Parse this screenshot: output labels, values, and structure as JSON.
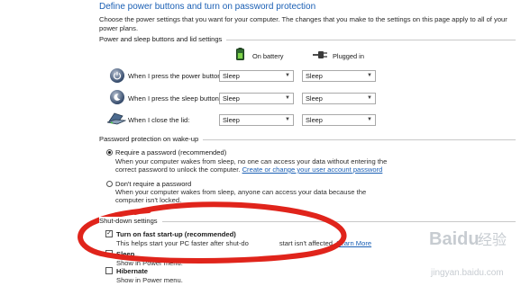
{
  "page": {
    "title": "Define power buttons and turn on password protection",
    "intro": "Choose the power settings that you want for your computer. The changes that you make to the settings on this page apply to all of your power plans."
  },
  "power_section": {
    "heading": "Power and sleep buttons and lid settings",
    "col_battery": "On battery",
    "col_plugged": "Plugged in",
    "rows": [
      {
        "label": "When I press the power button:",
        "battery": "Sleep",
        "plugged": "Sleep",
        "icon": "power-button-icon"
      },
      {
        "label": "When I press the sleep button:",
        "battery": "Sleep",
        "plugged": "Sleep",
        "icon": "sleep-button-icon"
      },
      {
        "label": "When I close the lid:",
        "battery": "Sleep",
        "plugged": "Sleep",
        "icon": "laptop-lid-icon"
      }
    ]
  },
  "password_section": {
    "heading": "Password protection on wake-up",
    "require_label": "Require a password (recommended)",
    "require_desc": "When your computer wakes from sleep, no one can access your data without entering the correct password to unlock the computer.",
    "require_link": "Create or change your user account password",
    "norequire_label": "Don't require a password",
    "norequire_desc": "When your computer wakes from sleep, anyone can access your data because the computer isn't locked.",
    "selected": "require"
  },
  "shutdown_section": {
    "heading": "Shut-down settings",
    "fast_label": "Turn on fast start-up (recommended)",
    "fast_desc_a": "This helps start your PC faster after shut-do",
    "fast_desc_b": "start isn't affected.",
    "learn_more": "Learn More",
    "fast_checked": true,
    "sleep_label": "Sleep",
    "sleep_desc": "Show in Power menu.",
    "hibernate_label": "Hibernate",
    "hibernate_desc": "Show in Power menu."
  },
  "colors": {
    "annotation_circle": "#e0241b",
    "link": "#1a5fb4",
    "title": "#1a5fb4"
  },
  "watermark": {
    "brand": "Baidu",
    "brand_cn": "经验",
    "url": "jingyan.baidu.com"
  }
}
